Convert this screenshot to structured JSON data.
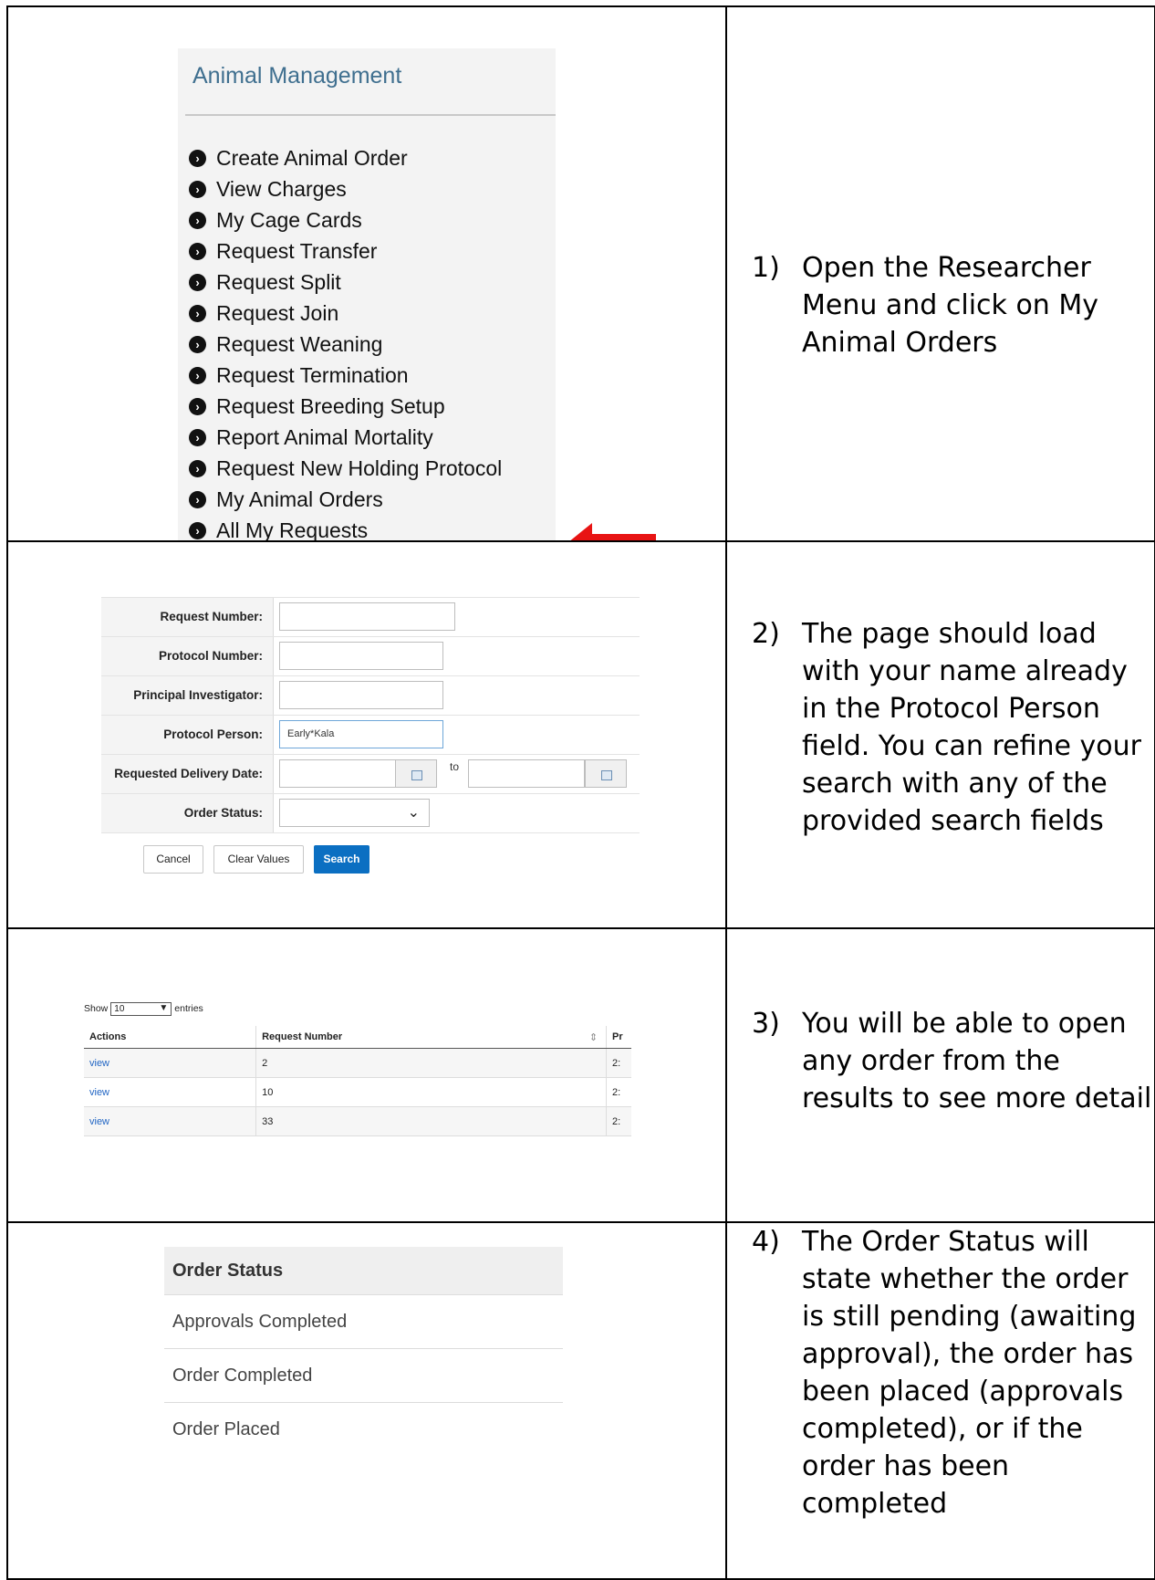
{
  "steps": [
    {
      "number": "1)",
      "text": "Open the Researcher Menu and click on My Animal Orders"
    },
    {
      "number": "2)",
      "text": "The page should load with your name already in the Protocol Person field. You can refine your search with any of the provided search fields"
    },
    {
      "number": "3)",
      "text": "You will be able to open any order from the results to see more detail"
    },
    {
      "number": "4)",
      "text": "The Order Status will state whether the order is still pending (awaiting approval), the order has been placed (approvals completed), or if the order has been completed"
    }
  ],
  "menu": {
    "title": "Animal Management",
    "items": [
      "Create Animal Order",
      "View Charges",
      "My Cage Cards",
      "Request Transfer",
      "Request Split",
      "Request Join",
      "Request Weaning",
      "Request Termination",
      "Request Breeding Setup",
      "Report Animal Mortality",
      "Request New Holding Protocol",
      "My Animal Orders",
      "All My Requests"
    ],
    "icon": "chevron-circle-right-icon",
    "highlight_color": "#e81414"
  },
  "search_form": {
    "fields": {
      "request_number": {
        "label": "Request Number:",
        "value": ""
      },
      "protocol_number": {
        "label": "Protocol Number:",
        "value": ""
      },
      "principal_investigator": {
        "label": "Principal Investigator:",
        "value": ""
      },
      "protocol_person": {
        "label": "Protocol Person:",
        "value": "Early*Kala"
      },
      "requested_delivery_date": {
        "label": "Requested Delivery Date:",
        "from": "",
        "to_label": "to",
        "to": ""
      },
      "order_status": {
        "label": "Order Status:",
        "value": ""
      }
    },
    "buttons": {
      "cancel": "Cancel",
      "clear": "Clear Values",
      "search": "Search"
    },
    "accent": "#0b6fc2"
  },
  "results": {
    "show_label": "Show",
    "page_size": "10",
    "entries_label": "entries",
    "columns": [
      "Actions",
      "Request Number",
      "Pr"
    ],
    "rows": [
      {
        "action": "view",
        "request_number": "2",
        "partial": "2:"
      },
      {
        "action": "view",
        "request_number": "10",
        "partial": "2:"
      },
      {
        "action": "view",
        "request_number": "33",
        "partial": "2:"
      }
    ]
  },
  "order_status": {
    "title": "Order Status",
    "items": [
      "Approvals Completed",
      "Order Completed",
      "Order Placed"
    ]
  }
}
